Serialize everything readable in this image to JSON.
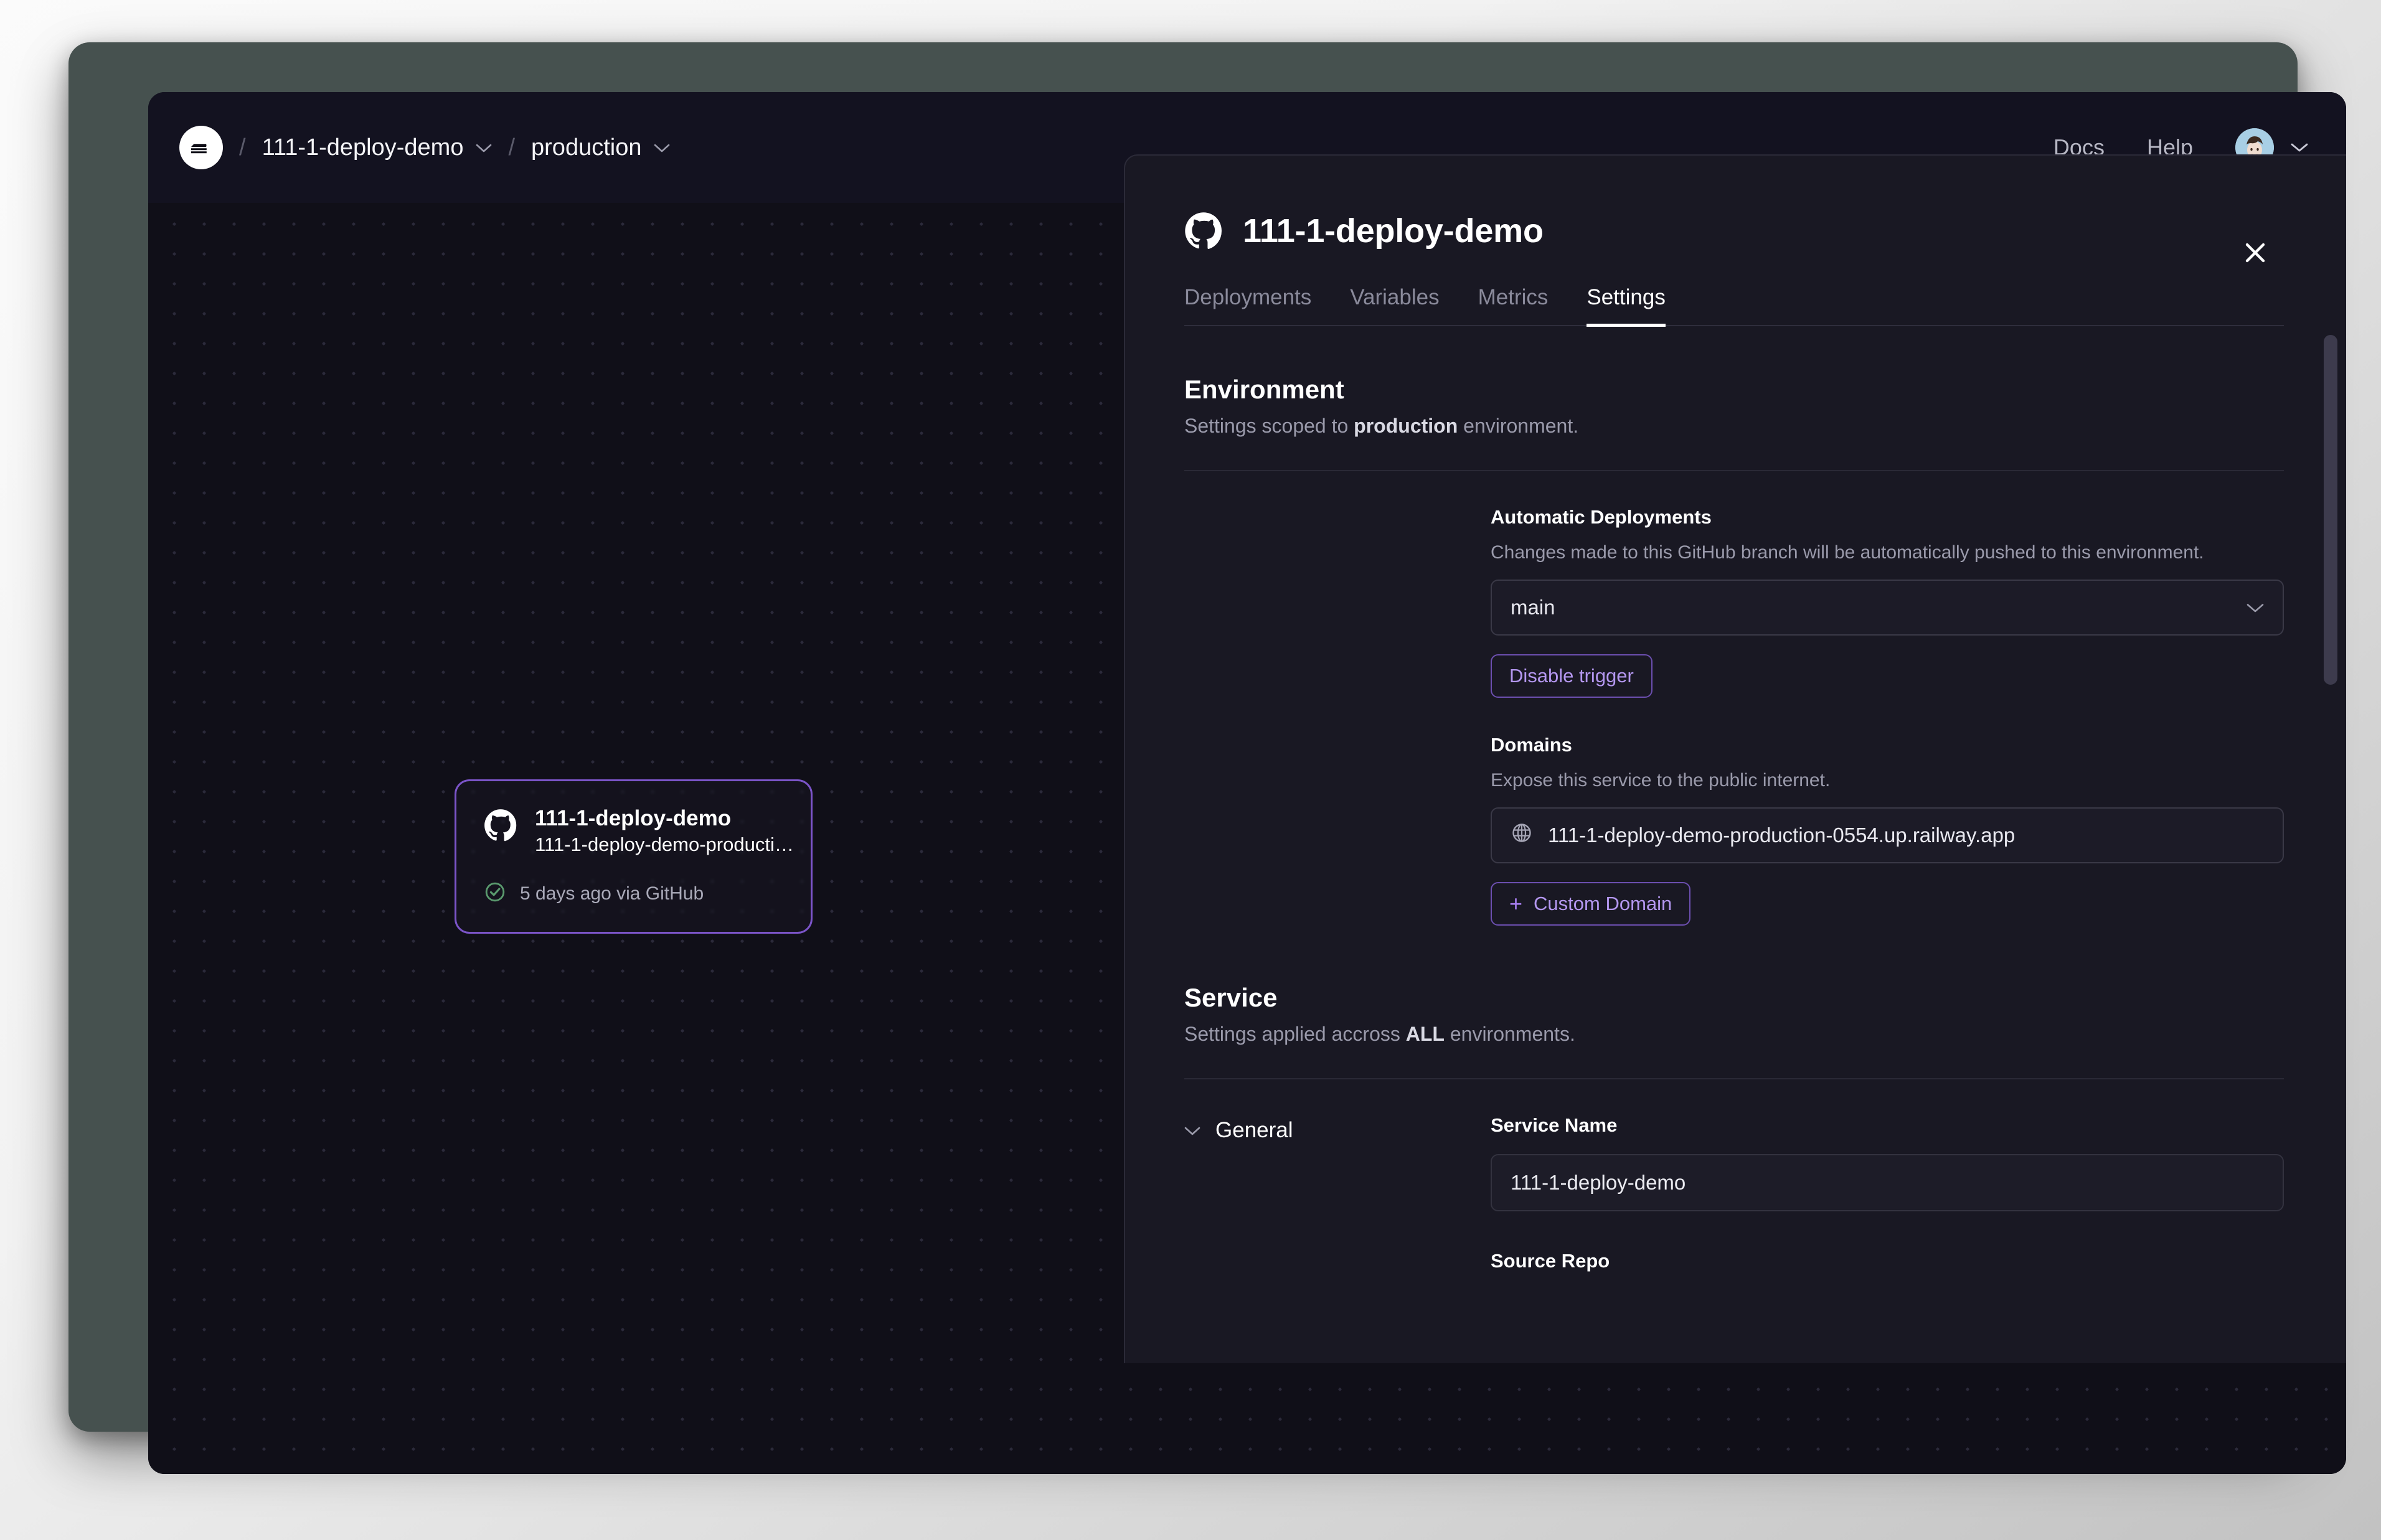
{
  "topbar": {
    "logo_icon": "railway-logo-icon",
    "breadcrumbs": [
      {
        "label": "111-1-deploy-demo",
        "chevron": "chevron-down-icon"
      },
      {
        "label": "production",
        "chevron": "chevron-down-icon"
      }
    ],
    "separator": "/",
    "links": [
      {
        "label": "Docs"
      },
      {
        "label": "Help"
      }
    ],
    "avatar_chevron": "chevron-down-icon"
  },
  "canvas": {
    "service_card": {
      "icon": "github-icon",
      "title": "111-1-deploy-demo",
      "subtitle": "111-1-deploy-demo-producti…",
      "status_icon": "check-circle-icon",
      "status_text": "5 days ago via GitHub",
      "border_color": "#7b54c8"
    }
  },
  "panel": {
    "icon": "github-icon",
    "title": "111-1-deploy-demo",
    "close_icon": "close-icon",
    "tabs": [
      {
        "label": "Deployments",
        "active": false
      },
      {
        "label": "Variables",
        "active": false
      },
      {
        "label": "Metrics",
        "active": false
      },
      {
        "label": "Settings",
        "active": true
      }
    ],
    "environment": {
      "title": "Environment",
      "desc_prefix": "Settings scoped to ",
      "desc_strong": "production",
      "desc_suffix": " environment.",
      "automatic_deployments": {
        "label": "Automatic Deployments",
        "help": "Changes made to this GitHub branch will be automatically pushed to this environment.",
        "branch_value": "main",
        "branch_chevron": "chevron-down-icon",
        "disable_button": "Disable trigger"
      },
      "domains": {
        "label": "Domains",
        "help": "Expose this service to the public internet.",
        "domain_icon": "globe-icon",
        "domain_value": "111-1-deploy-demo-production-0554.up.railway.app",
        "custom_domain_button": "Custom Domain",
        "custom_domain_plus": "+"
      }
    },
    "service": {
      "title": "Service",
      "desc_prefix": "Settings applied accross ",
      "desc_strong": "ALL",
      "desc_suffix": " environments.",
      "general": {
        "label": "General",
        "chevron": "chevron-down-icon",
        "service_name_label": "Service Name",
        "service_name_value": "111-1-deploy-demo",
        "source_repo_label": "Source Repo"
      }
    },
    "accent_purple": "#b497f0",
    "background": "#191823"
  }
}
